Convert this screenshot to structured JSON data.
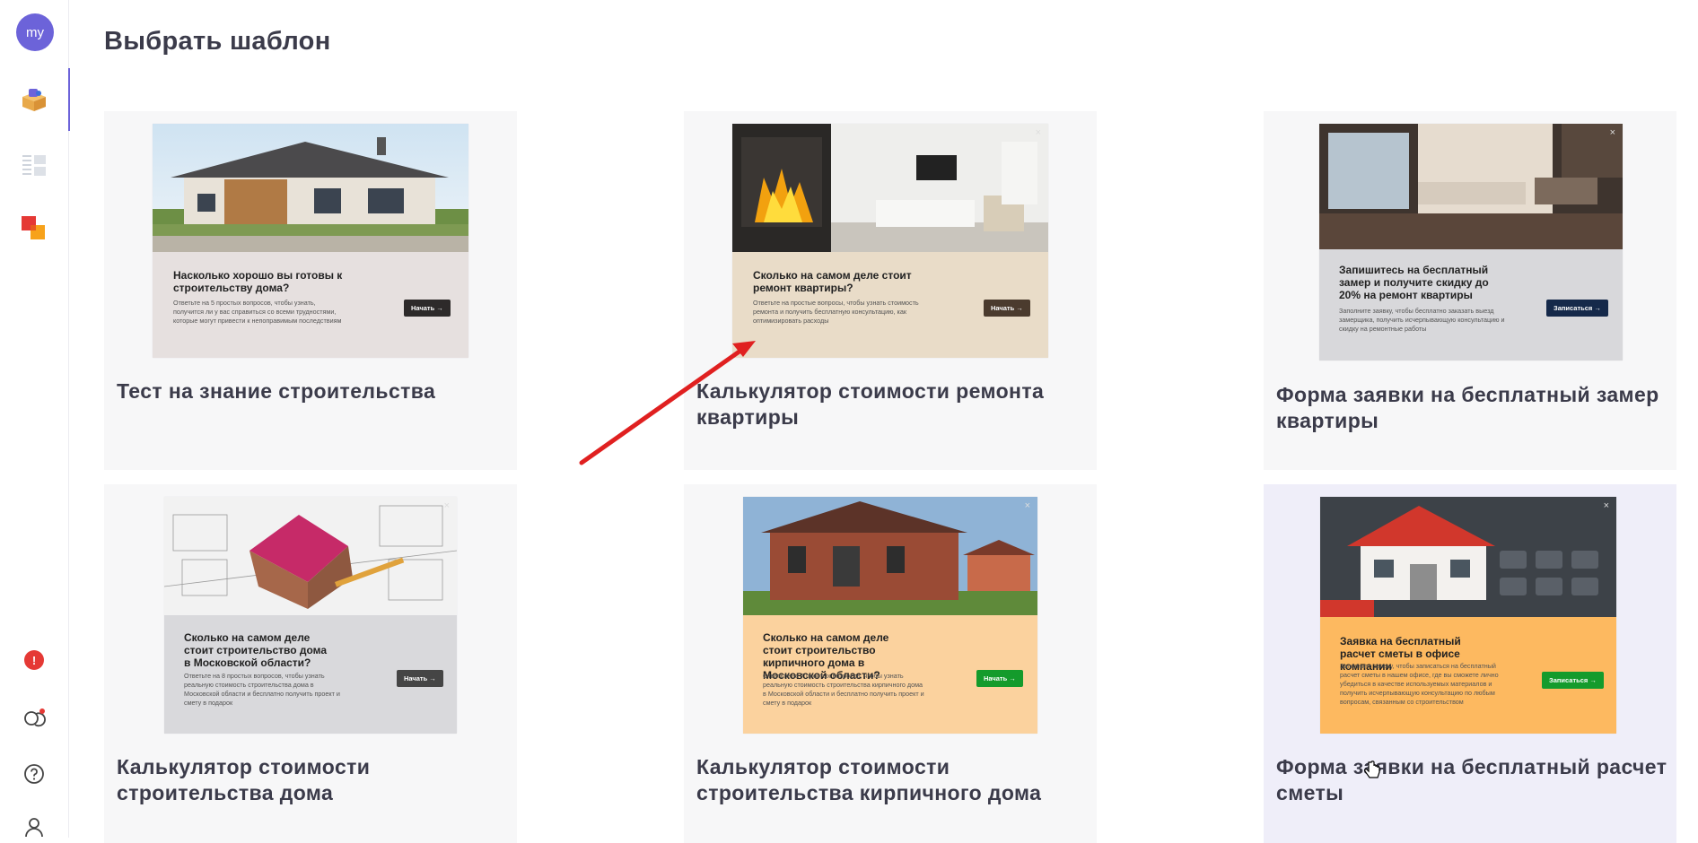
{
  "sidebar": {
    "avatar_text": "my",
    "alert_text": "!",
    "icons": [
      "templates-box-icon",
      "list-grid-icon",
      "color-blocks-icon",
      "alert-icon",
      "chat-icon",
      "help-icon",
      "user-icon"
    ]
  },
  "page": {
    "title": "Выбрать шаблон"
  },
  "cards": [
    {
      "title": "Тест на знание строительства",
      "panel_title": "Насколько хорошо вы готовы к строительству дома?",
      "panel_desc": "Ответьте на 5 простых вопросов, чтобы узнать, получится ли у вас справиться со всеми трудностями, которые могут привести к непоправимым последствиям",
      "button": "Начать →"
    },
    {
      "title": "Калькулятор стоимости ремонта квартиры",
      "panel_title": "Сколько на самом деле стоит ремонт квартиры?",
      "panel_desc": "Ответьте на простые вопросы, чтобы узнать стоимость ремонта и получить бесплатную консультацию, как оптимизировать расходы",
      "button": "Начать →"
    },
    {
      "title": "Форма заявки на бесплатный замер квартиры",
      "panel_title": "Запишитесь на бесплатный замер и получите скидку до 20% на ремонт квартиры",
      "panel_desc": "Заполните заявку, чтобы бесплатно заказать выезд замерщика, получить исчерпывающую консультацию и скидку на ремонтные работы",
      "button": "Записаться →"
    },
    {
      "title": "Калькулятор стоимости строительства дома",
      "panel_title": "Сколько на самом деле стоит строительство дома в Московской области?",
      "panel_desc": "Ответьте на 8 простых вопросов, чтобы узнать реальную стоимость строительства дома в Московской области и бесплатно получить проект и смету в подарок",
      "button": "Начать →"
    },
    {
      "title": "Калькулятор стоимости строительства кирпичного дома",
      "panel_title": "Сколько на самом деле стоит строительство кирпичного дома в Московской области?",
      "panel_desc": "Ответьте на 7 простых вопросов, чтобы узнать реальную стоимость строительства кирпичного дома в Московской области и бесплатно получить проект и смету в подарок",
      "button": "Начать →"
    },
    {
      "title": "Форма заявки на бесплатный расчет сметы",
      "panel_title": "Заявка на бесплатный расчет сметы в офисе компании",
      "panel_desc": "Заполните заявку, чтобы записаться на бесплатный расчет сметы в нашем офисе, где вы сможете лично убедиться в качестве используемых материалов и получить исчерпывающую консультацию по любым вопросам, связанным со строительством",
      "button": "Записаться →"
    }
  ],
  "colors": {
    "accent": "#6c63d9",
    "alert": "#e53935",
    "arrow": "#e02020"
  }
}
